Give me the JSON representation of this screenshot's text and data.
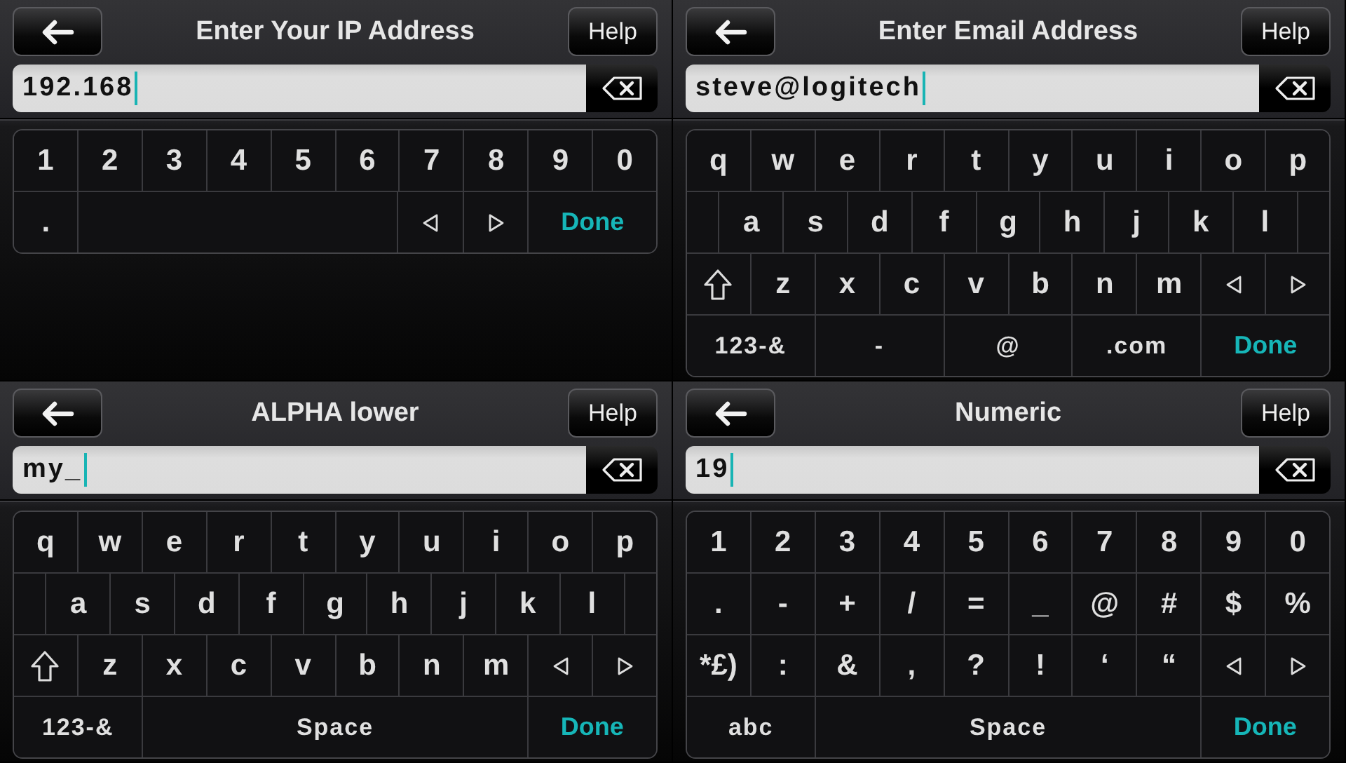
{
  "screens": [
    {
      "title": "Enter Your IP Address",
      "help": "Help",
      "field": {
        "value": "192.168"
      },
      "keyboard": [
        {
          "kind": "plain",
          "keys": [
            {
              "kind": "char",
              "label": "1"
            },
            {
              "kind": "char",
              "label": "2"
            },
            {
              "kind": "char",
              "label": "3"
            },
            {
              "kind": "char",
              "label": "4"
            },
            {
              "kind": "char",
              "label": "5"
            },
            {
              "kind": "char",
              "label": "6"
            },
            {
              "kind": "char",
              "label": "7"
            },
            {
              "kind": "char",
              "label": "8"
            },
            {
              "kind": "char",
              "label": "9"
            },
            {
              "kind": "char",
              "label": "0"
            }
          ]
        },
        {
          "kind": "plain",
          "keys": [
            {
              "kind": "char",
              "label": "."
            },
            {
              "kind": "blank"
            },
            {
              "kind": "left"
            },
            {
              "kind": "right"
            },
            {
              "kind": "done",
              "label": "Done"
            }
          ]
        }
      ]
    },
    {
      "title": "Enter Email Address",
      "help": "Help",
      "field": {
        "value": "steve@logitech"
      },
      "keyboard": [
        {
          "kind": "plain",
          "keys": [
            {
              "kind": "char",
              "label": "q"
            },
            {
              "kind": "char",
              "label": "w"
            },
            {
              "kind": "char",
              "label": "e"
            },
            {
              "kind": "char",
              "label": "r"
            },
            {
              "kind": "char",
              "label": "t"
            },
            {
              "kind": "char",
              "label": "y"
            },
            {
              "kind": "char",
              "label": "u"
            },
            {
              "kind": "char",
              "label": "i"
            },
            {
              "kind": "char",
              "label": "o"
            },
            {
              "kind": "char",
              "label": "p"
            }
          ]
        },
        {
          "kind": "offset",
          "keys": [
            {
              "kind": "char",
              "label": "a"
            },
            {
              "kind": "char",
              "label": "s"
            },
            {
              "kind": "char",
              "label": "d"
            },
            {
              "kind": "char",
              "label": "f"
            },
            {
              "kind": "char",
              "label": "g"
            },
            {
              "kind": "char",
              "label": "h"
            },
            {
              "kind": "char",
              "label": "j"
            },
            {
              "kind": "char",
              "label": "k"
            },
            {
              "kind": "char",
              "label": "l"
            }
          ]
        },
        {
          "kind": "plain",
          "keys": [
            {
              "kind": "shift"
            },
            {
              "kind": "char",
              "label": "z"
            },
            {
              "kind": "char",
              "label": "x"
            },
            {
              "kind": "char",
              "label": "c"
            },
            {
              "kind": "char",
              "label": "v"
            },
            {
              "kind": "char",
              "label": "b"
            },
            {
              "kind": "char",
              "label": "n"
            },
            {
              "kind": "char",
              "label": "m"
            },
            {
              "kind": "left"
            },
            {
              "kind": "right"
            }
          ]
        },
        {
          "kind": "plain",
          "keys": [
            {
              "kind": "wide",
              "label": "123-&"
            },
            {
              "kind": "wide",
              "label": "-"
            },
            {
              "kind": "wide",
              "label": "@"
            },
            {
              "kind": "wide",
              "label": ".com"
            },
            {
              "kind": "done",
              "label": "Done"
            }
          ]
        }
      ]
    },
    {
      "title": "ALPHA lower",
      "help": "Help",
      "field": {
        "value": "my_"
      },
      "keyboard": [
        {
          "kind": "plain",
          "keys": [
            {
              "kind": "char",
              "label": "q"
            },
            {
              "kind": "char",
              "label": "w"
            },
            {
              "kind": "char",
              "label": "e"
            },
            {
              "kind": "char",
              "label": "r"
            },
            {
              "kind": "char",
              "label": "t"
            },
            {
              "kind": "char",
              "label": "y"
            },
            {
              "kind": "char",
              "label": "u"
            },
            {
              "kind": "char",
              "label": "i"
            },
            {
              "kind": "char",
              "label": "o"
            },
            {
              "kind": "char",
              "label": "p"
            }
          ]
        },
        {
          "kind": "offset",
          "keys": [
            {
              "kind": "char",
              "label": "a"
            },
            {
              "kind": "char",
              "label": "s"
            },
            {
              "kind": "char",
              "label": "d"
            },
            {
              "kind": "char",
              "label": "f"
            },
            {
              "kind": "char",
              "label": "g"
            },
            {
              "kind": "char",
              "label": "h"
            },
            {
              "kind": "char",
              "label": "j"
            },
            {
              "kind": "char",
              "label": "k"
            },
            {
              "kind": "char",
              "label": "l"
            }
          ]
        },
        {
          "kind": "plain",
          "keys": [
            {
              "kind": "shift"
            },
            {
              "kind": "char",
              "label": "z"
            },
            {
              "kind": "char",
              "label": "x"
            },
            {
              "kind": "char",
              "label": "c"
            },
            {
              "kind": "char",
              "label": "v"
            },
            {
              "kind": "char",
              "label": "b"
            },
            {
              "kind": "char",
              "label": "n"
            },
            {
              "kind": "char",
              "label": "m"
            },
            {
              "kind": "left"
            },
            {
              "kind": "right"
            }
          ]
        },
        {
          "kind": "plain",
          "keys": [
            {
              "kind": "wide",
              "label": "123-&"
            },
            {
              "kind": "space",
              "label": "Space"
            },
            {
              "kind": "done",
              "label": "Done"
            }
          ]
        }
      ]
    },
    {
      "title": "Numeric",
      "help": "Help",
      "field": {
        "value": "19"
      },
      "keyboard": [
        {
          "kind": "plain",
          "keys": [
            {
              "kind": "char",
              "label": "1"
            },
            {
              "kind": "char",
              "label": "2"
            },
            {
              "kind": "char",
              "label": "3"
            },
            {
              "kind": "char",
              "label": "4"
            },
            {
              "kind": "char",
              "label": "5"
            },
            {
              "kind": "char",
              "label": "6"
            },
            {
              "kind": "char",
              "label": "7"
            },
            {
              "kind": "char",
              "label": "8"
            },
            {
              "kind": "char",
              "label": "9"
            },
            {
              "kind": "char",
              "label": "0"
            }
          ]
        },
        {
          "kind": "plain",
          "keys": [
            {
              "kind": "char",
              "label": "."
            },
            {
              "kind": "char",
              "label": "-"
            },
            {
              "kind": "char",
              "label": "+"
            },
            {
              "kind": "char",
              "label": "/"
            },
            {
              "kind": "char",
              "label": "="
            },
            {
              "kind": "char",
              "label": "_"
            },
            {
              "kind": "char",
              "label": "@"
            },
            {
              "kind": "char",
              "label": "#"
            },
            {
              "kind": "char",
              "label": "$"
            },
            {
              "kind": "char",
              "label": "%"
            }
          ]
        },
        {
          "kind": "plain",
          "keys": [
            {
              "kind": "char",
              "label": "*£)"
            },
            {
              "kind": "char",
              "label": ":"
            },
            {
              "kind": "char",
              "label": "&"
            },
            {
              "kind": "char",
              "label": ","
            },
            {
              "kind": "char",
              "label": "?"
            },
            {
              "kind": "char",
              "label": "!"
            },
            {
              "kind": "char",
              "label": "‘"
            },
            {
              "kind": "char",
              "label": "“"
            },
            {
              "kind": "left"
            },
            {
              "kind": "right"
            }
          ]
        },
        {
          "kind": "plain",
          "keys": [
            {
              "kind": "wide",
              "label": "abc"
            },
            {
              "kind": "space",
              "label": "Space"
            },
            {
              "kind": "done",
              "label": "Done"
            }
          ]
        }
      ]
    }
  ]
}
